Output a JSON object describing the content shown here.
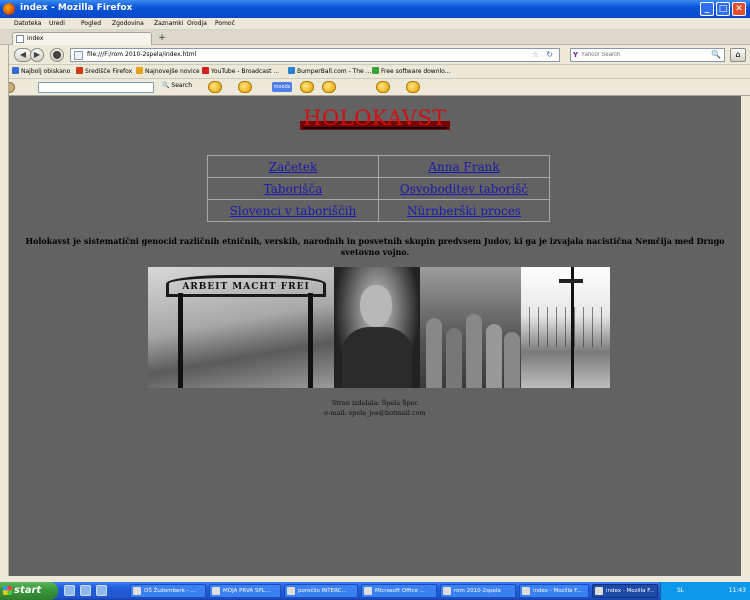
{
  "window": {
    "title": "index - Mozilla Firefox",
    "min_glyph": "_",
    "max_glyph": "□",
    "close_glyph": "✕"
  },
  "menu": [
    "Datoteka",
    "Uredi",
    "Pogled",
    "Zgodovina",
    "Zaznamki",
    "Orodja",
    "Pomoč"
  ],
  "tab": {
    "label": "index",
    "new_tab_glyph": "+"
  },
  "nav": {
    "back_glyph": "◀",
    "forward_glyph": "▶",
    "stop_glyph": "⬤",
    "url": "file:///F:/rom 2010-2spela/index.html",
    "search_placeholder": "Yahoo! Search",
    "home_glyph": "⌂"
  },
  "bookmarks": [
    {
      "label": "Najbolj obiskano",
      "color": "#3a6ad0"
    },
    {
      "label": "Središče Firefox",
      "color": "#d03a1a"
    },
    {
      "label": "Najnovejše novice",
      "color": "#e8a020"
    },
    {
      "label": "YouTube - Broadcast ...",
      "color": "#d02020"
    },
    {
      "label": "BumperBall.com - The ...",
      "color": "#2a80d0"
    },
    {
      "label": "Free software downlo...",
      "color": "#3aa03a"
    }
  ],
  "toolbar2": {
    "search_label": "Search",
    "mood_label": "moods"
  },
  "page": {
    "heading": "HOLOKAVST",
    "nav_links": [
      [
        "Začetek",
        "Anna Frank"
      ],
      [
        "Taborišča",
        "Osvoboditev taborišč"
      ],
      [
        "Slovenci v taboriščih",
        "Nürnberški proces"
      ]
    ],
    "intro": "Holokavst je sistematični genocid različnih etničnih, verskih, narodnih in posvetnih skupin predvsem Judov, ki ga je izvajala nacistična Nemčija med Drugo svetovno vojno.",
    "gate_text": "ARBEIT MACHT FREI",
    "credit_author": "Stran izdelala: Špela Špec",
    "credit_email": "e-mail: spela_jes@hotmail.com"
  },
  "taskbar": {
    "start": "start",
    "tasks": [
      "OŠ Žužemberk - ...",
      "MOJA PRVA SPL...",
      "poročilo INTERC...",
      "Microsoft Office ...",
      "rom 2010-2spela",
      "index - Mozilla F...",
      "index - Mozilla F..."
    ],
    "lang": "SL",
    "clock": "11:43"
  }
}
